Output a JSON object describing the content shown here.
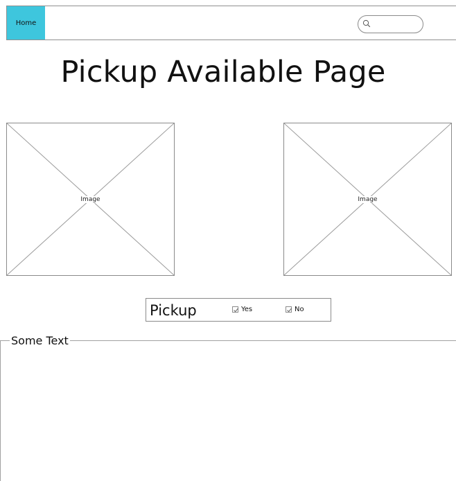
{
  "nav": {
    "home_label": "Home",
    "search_placeholder": "",
    "search_icon": "search-icon",
    "accent_color": "#3ec6dd"
  },
  "page": {
    "title": "Pickup Available Page"
  },
  "images": [
    {
      "label": "Image"
    },
    {
      "label": "Image"
    }
  ],
  "pickup": {
    "label": "Pickup",
    "options": [
      {
        "label": "Yes",
        "checked": true
      },
      {
        "label": "No",
        "checked": true
      }
    ]
  },
  "group": {
    "legend": "Some Text"
  }
}
